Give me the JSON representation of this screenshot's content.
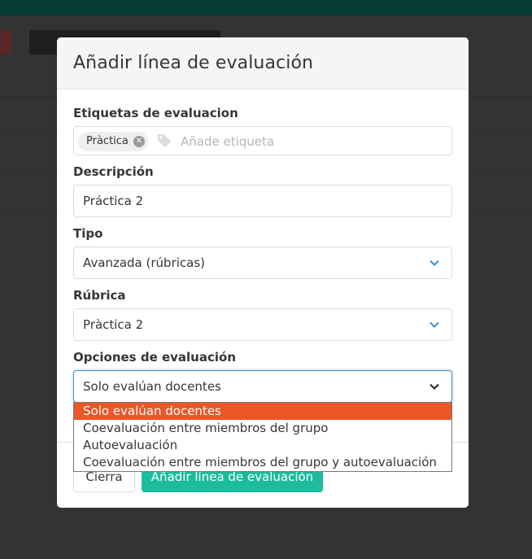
{
  "modal": {
    "title": "Añadir línea de evaluación",
    "fields": {
      "tags": {
        "label": "Etiquetas de evaluacion",
        "tag": "Pràctica",
        "placeholder": "Añade etiqueta"
      },
      "description": {
        "label": "Descripción",
        "value": "Práctica 2"
      },
      "type": {
        "label": "Tipo",
        "value": "Avanzada (rúbricas)"
      },
      "rubric": {
        "label": "Rúbrica",
        "value": "Pràctica 2"
      },
      "options": {
        "label": "Opciones de evaluación",
        "value": "Solo evalúan docentes",
        "items": [
          "Solo evalúan docentes",
          "Coevaluación entre miembros del grupo",
          "Autoevaluación",
          "Coevaluación entre miembros del grupo y autoevaluación"
        ],
        "selected_index": 0
      }
    },
    "footer": {
      "close_label": "Cierra",
      "add_label": "Añadir línea de evaluación"
    }
  },
  "colors": {
    "accent": "#1abc9c",
    "selected_option": "#ee5527",
    "chevron": "#3e8ed0"
  }
}
